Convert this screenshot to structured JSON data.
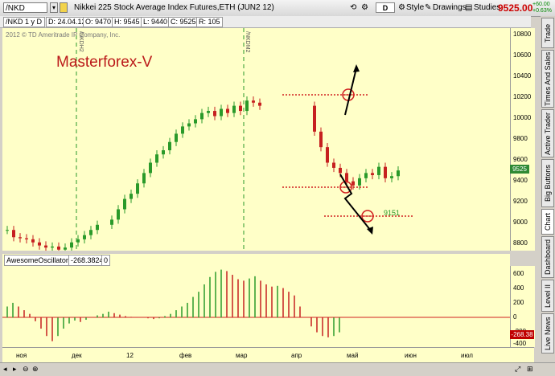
{
  "toolbar": {
    "symbol": "/NKD",
    "title": "Nikkei 225 Stock Average Index Futures,ETH (JUN2 12)",
    "d_button": "D",
    "style": "Style",
    "drawings": "Drawings",
    "studies": "Studies",
    "last_price": "9525.00",
    "change_abs": "+60.00",
    "change_pct": "+0.63%"
  },
  "info": {
    "symbol_period": "/NKD 1 y D",
    "date": "D: 24.04.12",
    "open": "O: 9470",
    "high": "H: 9545",
    "low": "L: 9440",
    "close": "C: 9525",
    "range": "R: 105"
  },
  "chart": {
    "copyright": "2012 © TD Ameritrade IP Company, Inc.",
    "overlay_title": "Masterforex-V",
    "marker_label_1": "/NKDH2",
    "marker_label_2": "/NKDM2",
    "annotation_value": "9151",
    "last_price_tag": "9525",
    "last_osc_tag": "-268.38"
  },
  "price_axis": [
    "10800",
    "10600",
    "10400",
    "10200",
    "10000",
    "9800",
    "9600",
    "9400",
    "9200",
    "9000",
    "8800"
  ],
  "oscillator": {
    "name": "AwesomeOscillator",
    "value": "-268.3824",
    "extra": "0",
    "axis": [
      "600",
      "400",
      "200",
      "0",
      "-200",
      "-400"
    ]
  },
  "time_axis": [
    "ноя",
    "дек",
    "12",
    "фев",
    "мар",
    "апр",
    "май",
    "июн",
    "июл"
  ],
  "side_tabs": [
    "Trade",
    "Times And Sales",
    "Active Trader",
    "Big Buttons",
    "Chart",
    "Dashboard",
    "Level II",
    "Live News"
  ],
  "colors": {
    "up": "#2a9a2a",
    "down": "#c62020",
    "background": "#ffffc8",
    "annotation": "#d02020"
  },
  "chart_data": {
    "type": "candlestick",
    "ohlc_last": {
      "open": 9470,
      "high": 9545,
      "low": 9440,
      "close": 9525
    },
    "price_ylim": [
      8750,
      10900
    ],
    "price_closes": [
      8950,
      8880,
      8870,
      8860,
      8830,
      8800,
      8780,
      8790,
      8760,
      8780,
      8830,
      8860,
      8900,
      8950,
      9000,
      9050,
      9150,
      9250,
      9300,
      9400,
      9500,
      9600,
      9680,
      9720,
      9800,
      9880,
      9950,
      9980,
      10020,
      10080,
      10100,
      10050,
      10120,
      10080,
      10150,
      10100,
      10200,
      10180,
      10150,
      9900,
      9750,
      9600,
      9550,
      9500,
      9420,
      9380,
      9450,
      9500,
      9480,
      9560,
      9450,
      9470,
      9525
    ],
    "oscillator_ylim": [
      -400,
      700
    ],
    "oscillator_values": [
      150,
      200,
      150,
      100,
      50,
      -50,
      -150,
      -250,
      -320,
      -250,
      -150,
      -80,
      -40,
      -60,
      -30,
      0,
      30,
      50,
      80,
      60,
      40,
      20,
      10,
      5,
      0,
      -10,
      -20,
      -10,
      20,
      50,
      100,
      150,
      200,
      280,
      350,
      450,
      550,
      620,
      650,
      630,
      580,
      520,
      500,
      530,
      560,
      500,
      450,
      420,
      430,
      400,
      350,
      300,
      150,
      0,
      -120,
      -200,
      -250,
      -268,
      -250,
      -200
    ]
  }
}
